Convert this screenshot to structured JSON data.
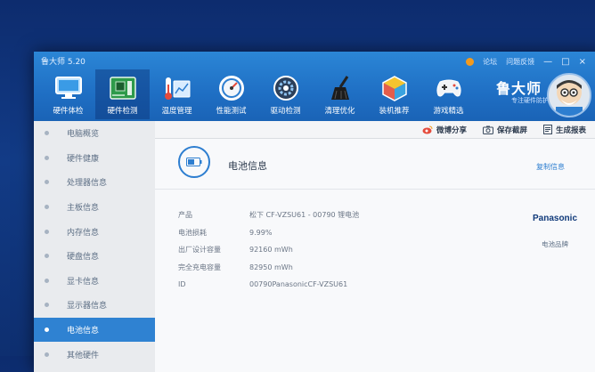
{
  "window": {
    "title": "鲁大师 5.20",
    "links": [
      "论坛",
      "问题反馈"
    ],
    "controls": [
      "—",
      "□",
      "×"
    ]
  },
  "toolbar": {
    "items": [
      {
        "label": "硬件体检",
        "icon": "monitor-icon"
      },
      {
        "label": "硬件检测",
        "icon": "circuit-board-icon"
      },
      {
        "label": "温度管理",
        "icon": "thermometer-icon"
      },
      {
        "label": "性能测试",
        "icon": "gauge-icon"
      },
      {
        "label": "驱动检测",
        "icon": "gear-icon"
      },
      {
        "label": "清理优化",
        "icon": "broom-icon"
      },
      {
        "label": "装机推荐",
        "icon": "cube-icon"
      },
      {
        "label": "游戏精选",
        "icon": "gamepad-icon"
      }
    ],
    "active_index": 1
  },
  "brand": {
    "name": "鲁大师",
    "tagline": "专注硬件防护"
  },
  "sidebar": {
    "items": [
      "电脑概览",
      "硬件健康",
      "处理器信息",
      "主板信息",
      "内存信息",
      "硬盘信息",
      "显卡信息",
      "显示器信息",
      "电池信息",
      "其他硬件"
    ],
    "active_index": 8
  },
  "actions": {
    "share": "微博分享",
    "save_screenshot": "保存截屏",
    "generate_report": "生成报表"
  },
  "battery": {
    "title": "电池信息",
    "copy_label": "复制信息",
    "rows": [
      {
        "key": "产品",
        "value": "松下 CF-VZSU61 - 00790 锂电池"
      },
      {
        "key": "电池损耗",
        "value": "9.99%"
      },
      {
        "key": "出厂设计容量",
        "value": "92160 mWh"
      },
      {
        "key": "完全充电容量",
        "value": "82950 mWh"
      },
      {
        "key": "ID",
        "value": "00790PanasonicCF-VZSU61"
      }
    ],
    "brand_logo": "Panasonic",
    "brand_caption": "电池品牌"
  },
  "colors": {
    "header_blue": "#1f6fc4",
    "accent_blue": "#2f82d2",
    "brand_navy": "#103a7a"
  }
}
